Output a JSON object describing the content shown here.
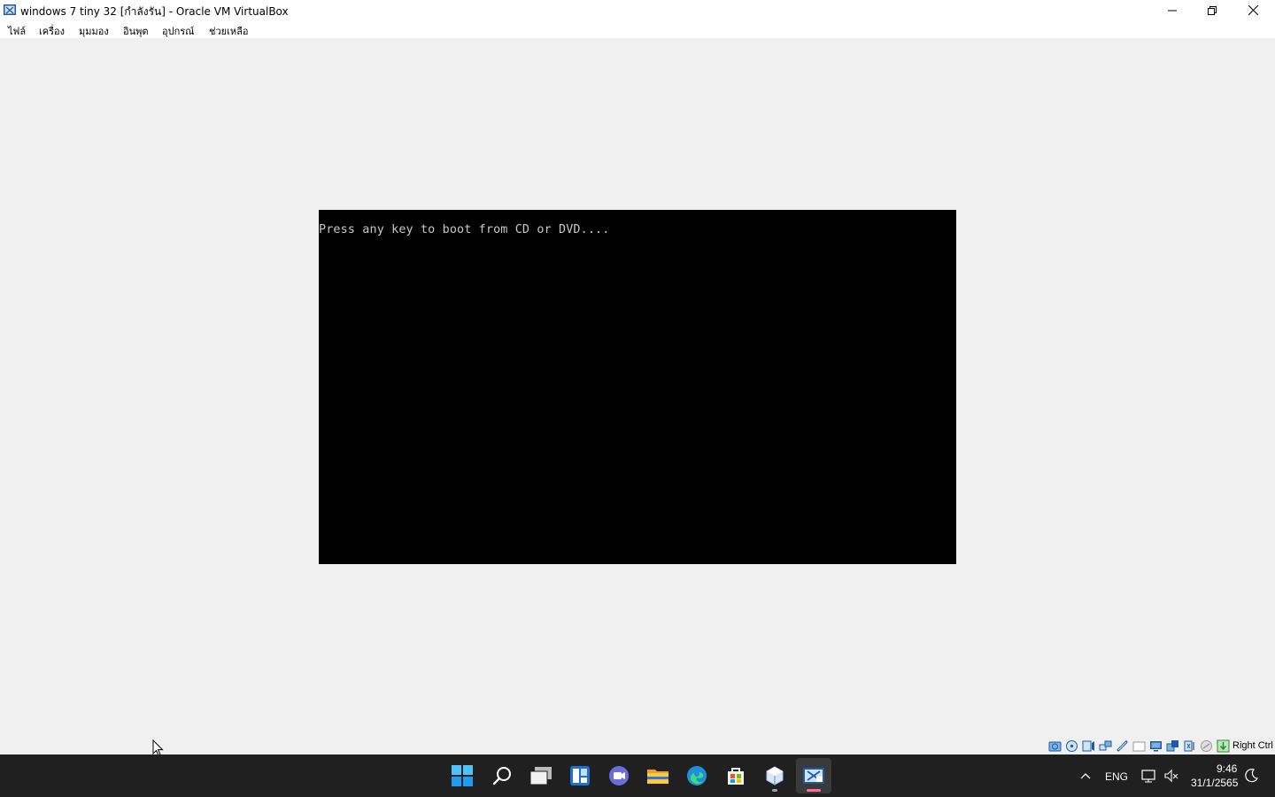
{
  "window": {
    "title": "windows 7 tiny 32 [กำลังรัน] - Oracle VM VirtualBox",
    "controls": [
      "minimize-icon",
      "restore-icon",
      "close-icon"
    ]
  },
  "menu": {
    "items": [
      {
        "label": "ไฟล์"
      },
      {
        "label": "เครื่อง"
      },
      {
        "label": "มุมมอง"
      },
      {
        "label": "อินพุต"
      },
      {
        "label": "อุปกรณ์"
      },
      {
        "label": "ช่วยเหลือ"
      }
    ]
  },
  "vm": {
    "boot_message": "Press any key to boot from CD or DVD...."
  },
  "statusbar": {
    "icons": [
      "hard-disk-icon",
      "optical-drive-icon",
      "audio-icon",
      "network-icon",
      "usb-icon",
      "shared-folders-icon",
      "display-icon",
      "video-capture-icon",
      "cpu-icon",
      "mouse-integration-icon",
      "keyboard-capture-icon"
    ],
    "host_key_label": "Right Ctrl"
  },
  "taskbar": {
    "apps": [
      {
        "name": "start-button"
      },
      {
        "name": "search-button"
      },
      {
        "name": "task-view-button"
      },
      {
        "name": "widgets-button"
      },
      {
        "name": "chat-button"
      },
      {
        "name": "file-explorer-button"
      },
      {
        "name": "edge-button"
      },
      {
        "name": "store-button"
      },
      {
        "name": "virtualbox-manager-button"
      },
      {
        "name": "virtualbox-vm-button",
        "active": true
      }
    ],
    "tray": {
      "language": "ENG",
      "time": "9:46",
      "date": "31/1/2565"
    }
  },
  "colors": {
    "taskbar_bg": "#202020",
    "vm_screen_bg": "#000000",
    "boot_text": "#c8c8c8",
    "app_bg": "#f0f0f0"
  }
}
